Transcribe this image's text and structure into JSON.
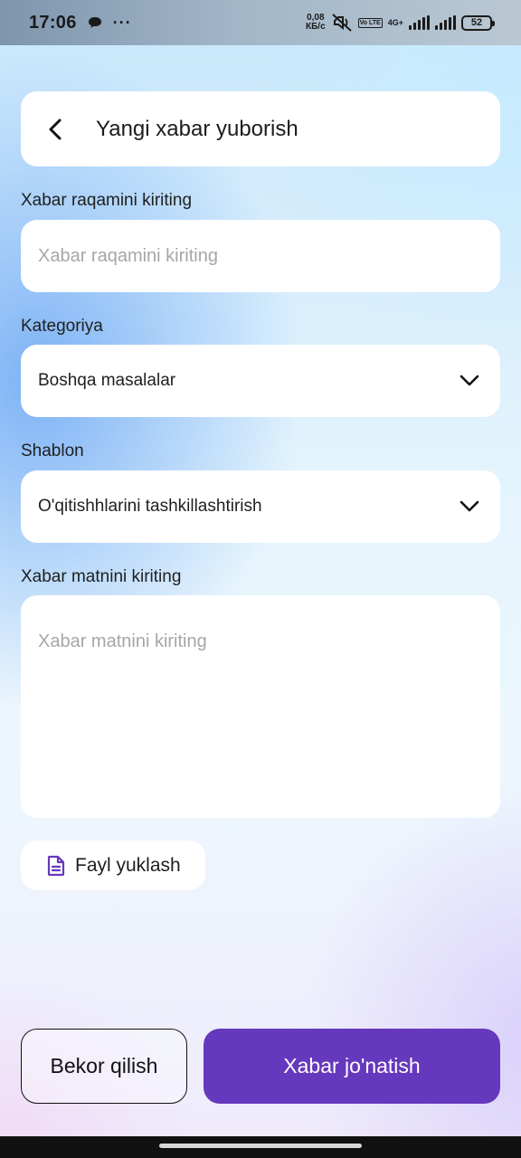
{
  "status_bar": {
    "time": "17:06",
    "dots": "···",
    "speed_value": "0,08",
    "speed_unit": "КБ/с",
    "volte_badge": "Vo LTE",
    "network_label": "4G+",
    "battery": "52"
  },
  "header": {
    "title": "Yangi xabar yuborish"
  },
  "form": {
    "number_label": "Xabar raqamini kiriting",
    "number_placeholder": "Xabar raqamini kiriting",
    "number_value": "",
    "category_label": "Kategoriya",
    "category_value": "Boshqa masalalar",
    "template_label": "Shablon",
    "template_value": "O'qitishhlarini tashkillashtirish",
    "message_label": "Xabar matnini kiriting",
    "message_placeholder": "Xabar matnini kiriting",
    "message_value": ""
  },
  "upload": {
    "label": "Fayl yuklash"
  },
  "actions": {
    "cancel_label": "Bekor qilish",
    "submit_label": "Xabar jo'natish"
  },
  "colors": {
    "accent": "#6638bd",
    "card": "#ffffff",
    "text": "#1f1f1f",
    "placeholder": "#a6a6a6"
  },
  "icons": {
    "back": "chevron-left-icon",
    "dropdown": "chevron-down-icon",
    "file": "document-icon",
    "chat": "chat-bubble-icon",
    "mute": "muted-icon",
    "signal": "signal-bars-icon",
    "battery": "battery-icon"
  }
}
